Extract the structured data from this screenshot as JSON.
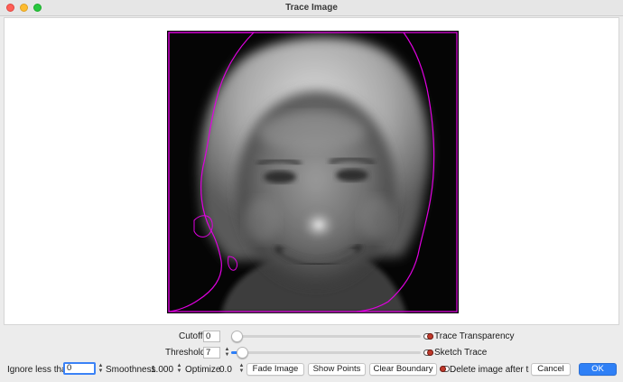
{
  "window": {
    "title": "Trace Image"
  },
  "controls": {
    "cutoff": {
      "label": "Cutoff",
      "value": "0",
      "slider_fraction": 0.0
    },
    "threshold": {
      "label": "Threshold",
      "value": "7",
      "slider_fraction": 0.03
    },
    "trace_transparency": {
      "label": "Trace Transparency",
      "checked": false
    },
    "sketch_trace": {
      "label": "Sketch Trace",
      "checked": false
    },
    "ignore_less_than": {
      "label": "Ignore less than",
      "value": "0"
    },
    "smoothness": {
      "label": "Smoothness",
      "value": "1.000"
    },
    "optimize": {
      "label": "Optimize",
      "value": "0.0"
    },
    "delete_after": {
      "label": "Delete image after trac",
      "checked": true
    }
  },
  "buttons": {
    "fade_image": "Fade Image",
    "show_points": "Show Points",
    "clear_boundary": "Clear Boundary",
    "cancel": "Cancel",
    "ok": "OK"
  },
  "colors": {
    "accent": "#2f80f6",
    "trace_outline": "#e000e0",
    "toggle_dot": "#c0392b"
  }
}
